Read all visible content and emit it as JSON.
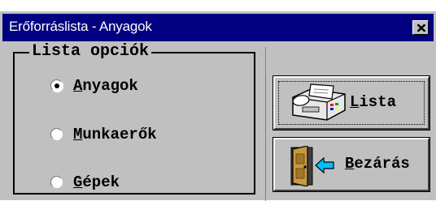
{
  "window": {
    "title": "Erőforráslista - Anyagok"
  },
  "options_group": {
    "title": "Lista opciók",
    "items": [
      {
        "label_first": "A",
        "label_rest": "nyagok",
        "selected": true
      },
      {
        "label_first": "M",
        "label_rest": "unkaerők",
        "selected": false
      },
      {
        "label_first": "G",
        "label_rest": "épek",
        "selected": false
      }
    ]
  },
  "buttons": {
    "list": {
      "label_first": "L",
      "label_rest": "ista",
      "icon": "fax-printer-icon"
    },
    "close": {
      "label_first": "B",
      "label_rest": "ezárás",
      "icon": "door-exit-icon"
    }
  },
  "colors": {
    "titlebar": "#000080",
    "face": "#c0c0c0"
  }
}
